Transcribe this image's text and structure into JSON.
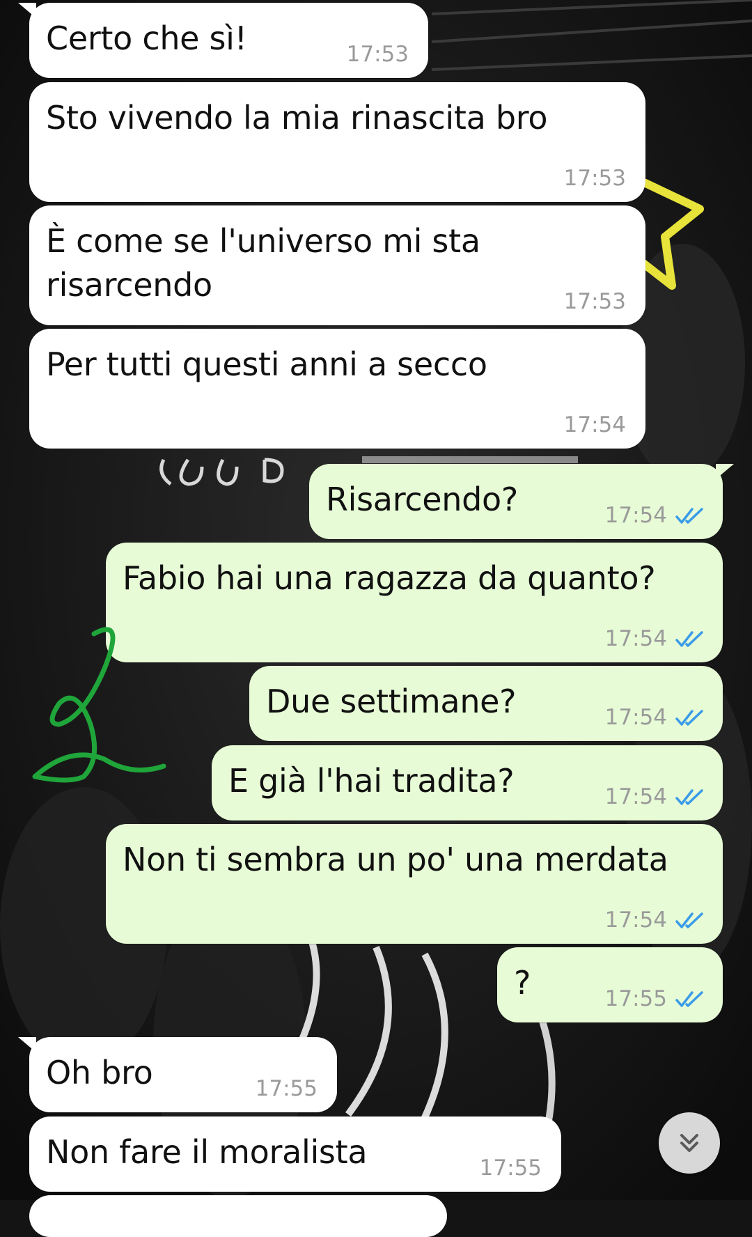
{
  "messages": [
    {
      "text": "Certo che sì!",
      "time": "17:53",
      "dir": "in"
    },
    {
      "text": "Sto vivendo la mia rinascita bro",
      "time": "17:53",
      "dir": "in"
    },
    {
      "text_line1": "È come se l'universo mi sta",
      "text_line2": "risarcendo",
      "time": "17:53",
      "dir": "in"
    },
    {
      "text": "Per tutti questi anni a secco",
      "time": "17:54",
      "dir": "in"
    },
    {
      "text": "Risarcendo?",
      "time": "17:54",
      "dir": "out"
    },
    {
      "text": "Fabio hai una ragazza da quanto?",
      "time": "17:54",
      "dir": "out"
    },
    {
      "text": "Due settimane?",
      "time": "17:54",
      "dir": "out"
    },
    {
      "text": "E già l'hai tradita?",
      "time": "17:54",
      "dir": "out"
    },
    {
      "text": "Non ti sembra un po' una merdata",
      "time": "17:54",
      "dir": "out"
    },
    {
      "text": "?",
      "time": "17:55",
      "dir": "out"
    },
    {
      "text": "Oh bro",
      "time": "17:55",
      "dir": "in"
    },
    {
      "text": "Non fare il moralista",
      "time": "17:55",
      "dir": "in"
    }
  ],
  "colors": {
    "incoming_bubble": "#ffffff",
    "outgoing_bubble": "#e7fcd6",
    "read_ticks": "#3a9be8",
    "timestamp": "#9a9a9a",
    "doodle": "#1fa53a"
  },
  "icons": {
    "read_receipt": "double-check-icon",
    "scroll_down": "chevron-double-down-icon"
  }
}
